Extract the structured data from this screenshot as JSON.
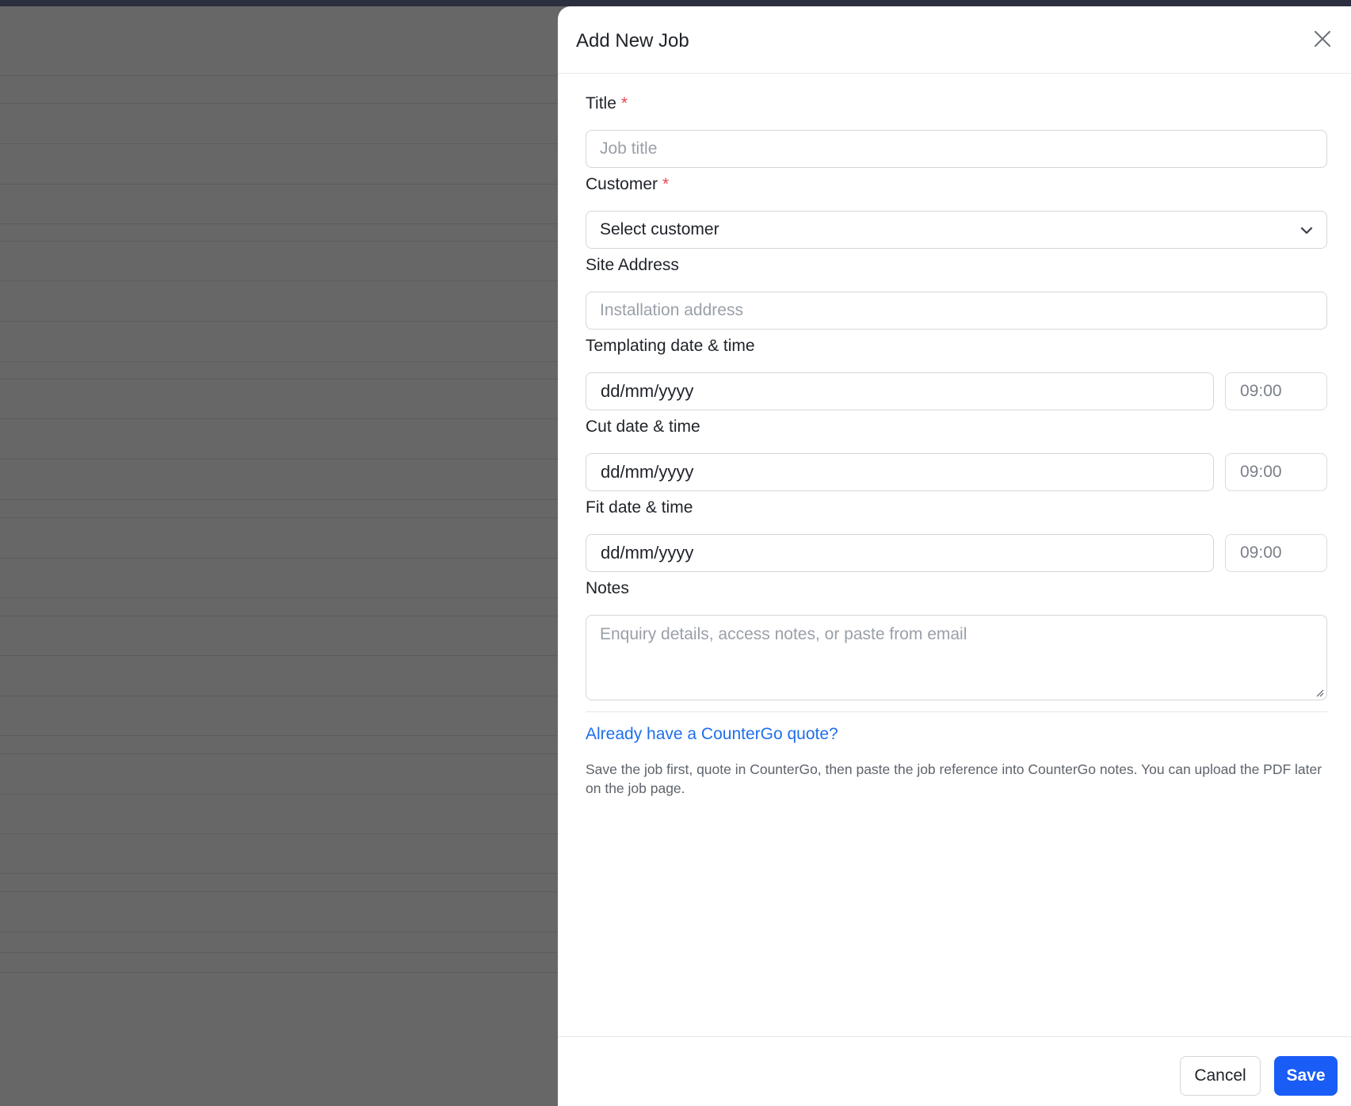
{
  "drawer": {
    "title": "Add New Job"
  },
  "fields": {
    "title": {
      "label": "Title",
      "required_mark": "*",
      "placeholder": "Job title"
    },
    "customer": {
      "label": "Customer",
      "required_mark": "*",
      "value": "Select customer"
    },
    "site_address": {
      "label": "Site Address",
      "placeholder": "Installation address"
    },
    "templating": {
      "label": "Templating date & time",
      "date": "dd/mm/yyyy",
      "time": "09:00"
    },
    "cut": {
      "label": "Cut date & time",
      "date": "dd/mm/yyyy",
      "time": "09:00"
    },
    "fit": {
      "label": "Fit date & time",
      "date": "dd/mm/yyyy",
      "time": "09:00"
    },
    "notes": {
      "label": "Notes",
      "placeholder": "Enquiry details, access notes, or paste from email"
    }
  },
  "quote": {
    "link": "Already have a CounterGo quote?",
    "help": "Save the job first, quote in CounterGo, then paste the job reference into CounterGo notes. You can upload the PDF later on the job page."
  },
  "footer": {
    "cancel_label": "Cancel",
    "save_label": "Save"
  },
  "icons": {
    "close": "close-icon",
    "chevron": "chevron-down-icon"
  },
  "colors": {
    "primary": "#1a5cf6",
    "link": "#1f6feb",
    "required": "#e5484d",
    "backdrop": "#676767"
  }
}
